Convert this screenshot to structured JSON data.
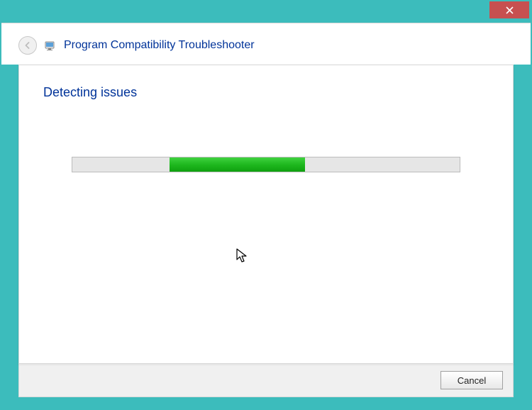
{
  "window": {
    "title": "Program Compatibility Troubleshooter"
  },
  "content": {
    "heading": "Detecting issues"
  },
  "footer": {
    "cancel_label": "Cancel"
  },
  "progress": {
    "mode": "indeterminate"
  },
  "icons": {
    "back": "back-arrow-icon",
    "app": "troubleshooter-icon",
    "close": "close-icon"
  }
}
